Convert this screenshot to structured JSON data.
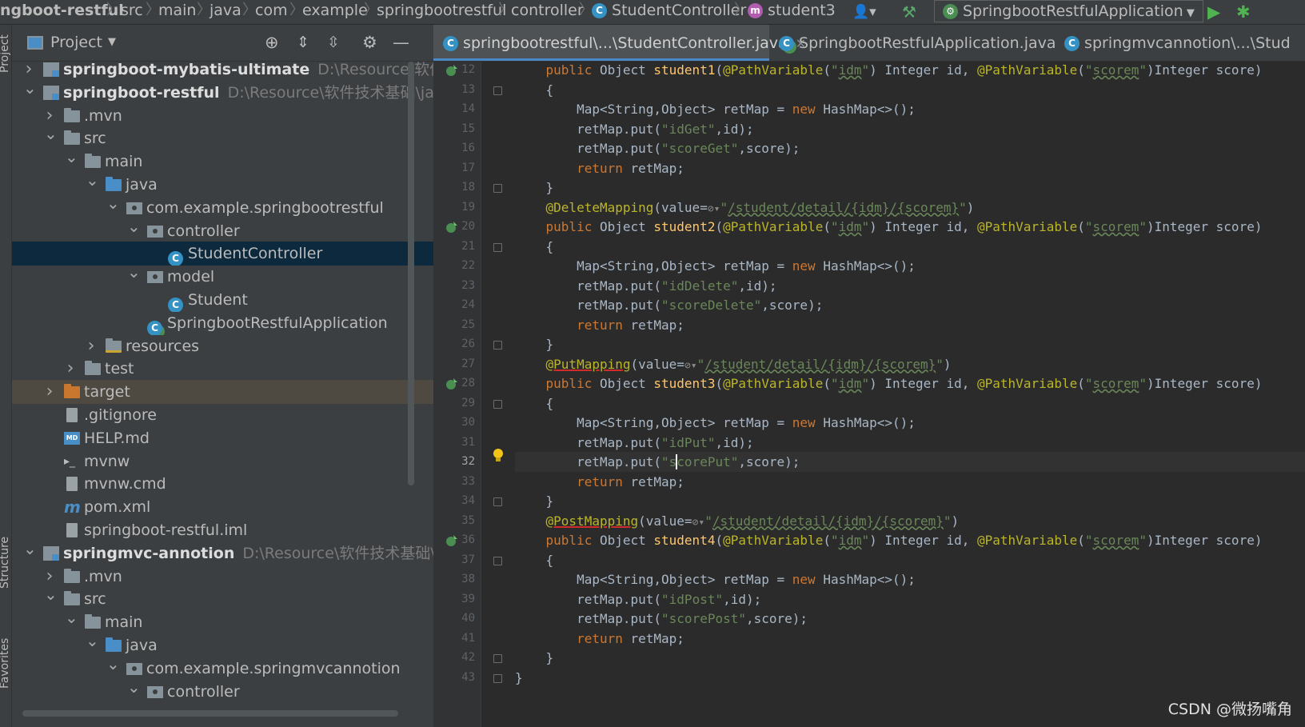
{
  "breadcrumb": [
    "ngboot-restful",
    "src",
    "main",
    "java",
    "com",
    "example",
    "springbootrestful",
    "controller",
    "StudentController",
    "student3"
  ],
  "run_config": "SpringbootRestfulApplication",
  "side_labels": [
    "Project",
    "Structure",
    "Favorites"
  ],
  "project_panel": {
    "title": "Project"
  },
  "tree": [
    {
      "label": "springboot-mybatis-ultimate",
      "path": "D:\\Resource\\软件技术基",
      "depth": 0,
      "expanded": false,
      "icon": "module",
      "bold": true
    },
    {
      "label": "springboot-restful",
      "path": "D:\\Resource\\软件技术基础\\java-le",
      "depth": 0,
      "expanded": true,
      "icon": "module",
      "bold": true
    },
    {
      "label": ".mvn",
      "depth": 1,
      "expanded": false,
      "icon": "folder"
    },
    {
      "label": "src",
      "depth": 1,
      "expanded": true,
      "icon": "folder"
    },
    {
      "label": "main",
      "depth": 2,
      "expanded": true,
      "icon": "folder"
    },
    {
      "label": "java",
      "depth": 3,
      "expanded": true,
      "icon": "folder-blue"
    },
    {
      "label": "com.example.springbootrestful",
      "depth": 4,
      "expanded": true,
      "icon": "package"
    },
    {
      "label": "controller",
      "depth": 5,
      "expanded": true,
      "icon": "package"
    },
    {
      "label": "StudentController",
      "depth": 6,
      "icon": "class",
      "selected": true
    },
    {
      "label": "model",
      "depth": 5,
      "expanded": true,
      "icon": "package"
    },
    {
      "label": "Student",
      "depth": 6,
      "icon": "class"
    },
    {
      "label": "SpringbootRestfulApplication",
      "depth": 5,
      "icon": "spring-class"
    },
    {
      "label": "resources",
      "depth": 3,
      "expanded": false,
      "icon": "resources"
    },
    {
      "label": "test",
      "depth": 2,
      "expanded": false,
      "icon": "folder"
    },
    {
      "label": "target",
      "depth": 1,
      "expanded": false,
      "icon": "folder-orange",
      "highlight": true
    },
    {
      "label": ".gitignore",
      "depth": 1,
      "icon": "file"
    },
    {
      "label": "HELP.md",
      "depth": 1,
      "icon": "md"
    },
    {
      "label": "mvnw",
      "depth": 1,
      "icon": "terminal"
    },
    {
      "label": "mvnw.cmd",
      "depth": 1,
      "icon": "file"
    },
    {
      "label": "pom.xml",
      "depth": 1,
      "icon": "maven"
    },
    {
      "label": "springboot-restful.iml",
      "depth": 1,
      "icon": "file"
    },
    {
      "label": "springmvc-annotion",
      "path": "D:\\Resource\\软件技术基础\\java-",
      "depth": 0,
      "expanded": true,
      "icon": "module",
      "bold": true
    },
    {
      "label": ".mvn",
      "depth": 1,
      "expanded": false,
      "icon": "folder"
    },
    {
      "label": "src",
      "depth": 1,
      "expanded": true,
      "icon": "folder"
    },
    {
      "label": "main",
      "depth": 2,
      "expanded": true,
      "icon": "folder"
    },
    {
      "label": "java",
      "depth": 3,
      "expanded": true,
      "icon": "folder-blue"
    },
    {
      "label": "com.example.springmvcannotion",
      "depth": 4,
      "expanded": true,
      "icon": "package"
    },
    {
      "label": "controller",
      "depth": 5,
      "expanded": true,
      "icon": "package"
    }
  ],
  "tabs": [
    {
      "label": "springbootrestful\\...\\StudentController.java",
      "icon": "class",
      "active": true,
      "closable": true
    },
    {
      "label": "SpringbootRestfulApplication.java",
      "icon": "spring-class",
      "closable": true
    },
    {
      "label": "springmvcannotion\\...\\Stud",
      "icon": "class"
    }
  ],
  "code": {
    "current_line": 32,
    "lines": [
      {
        "n": 12,
        "t": "    public Object student1(@PathVariable(\"idm\") Integer id, @PathVariable(\"scorem\")Integer score)"
      },
      {
        "n": 13,
        "t": "    {"
      },
      {
        "n": 14,
        "t": "        Map<String,Object> retMap = new HashMap<>();"
      },
      {
        "n": 15,
        "t": "        retMap.put(\"idGet\",id);"
      },
      {
        "n": 16,
        "t": "        retMap.put(\"scoreGet\",score);"
      },
      {
        "n": 17,
        "t": "        return retMap;"
      },
      {
        "n": 18,
        "t": "    }"
      },
      {
        "n": 19,
        "t": "    @DeleteMapping(value=\"/student/detail/{idm}/{scorem}\")"
      },
      {
        "n": 20,
        "t": "    public Object student2(@PathVariable(\"idm\") Integer id, @PathVariable(\"scorem\")Integer score)"
      },
      {
        "n": 21,
        "t": "    {"
      },
      {
        "n": 22,
        "t": "        Map<String,Object> retMap = new HashMap<>();"
      },
      {
        "n": 23,
        "t": "        retMap.put(\"idDelete\",id);"
      },
      {
        "n": 24,
        "t": "        retMap.put(\"scoreDelete\",score);"
      },
      {
        "n": 25,
        "t": "        return retMap;"
      },
      {
        "n": 26,
        "t": "    }"
      },
      {
        "n": 27,
        "t": "    @PutMapping(value=\"/student/detail/{idm}/{scorem}\")"
      },
      {
        "n": 28,
        "t": "    public Object student3(@PathVariable(\"idm\") Integer id, @PathVariable(\"scorem\")Integer score)"
      },
      {
        "n": 29,
        "t": "    {"
      },
      {
        "n": 30,
        "t": "        Map<String,Object> retMap = new HashMap<>();"
      },
      {
        "n": 31,
        "t": "        retMap.put(\"idPut\",id);"
      },
      {
        "n": 32,
        "t": "        retMap.put(\"scorePut\",score);"
      },
      {
        "n": 33,
        "t": "        return retMap;"
      },
      {
        "n": 34,
        "t": "    }"
      },
      {
        "n": 35,
        "t": "    @PostMapping(value=\"/student/detail/{idm}/{scorem}\")"
      },
      {
        "n": 36,
        "t": "    public Object student4(@PathVariable(\"idm\") Integer id, @PathVariable(\"scorem\")Integer score)"
      },
      {
        "n": 37,
        "t": "    {"
      },
      {
        "n": 38,
        "t": "        Map<String,Object> retMap = new HashMap<>();"
      },
      {
        "n": 39,
        "t": "        retMap.put(\"idPost\",id);"
      },
      {
        "n": 40,
        "t": "        retMap.put(\"scorePost\",score);"
      },
      {
        "n": 41,
        "t": "        return retMap;"
      },
      {
        "n": 42,
        "t": "    }"
      },
      {
        "n": 43,
        "t": "}"
      }
    ]
  },
  "watermark": "CSDN @微扬嘴角",
  "colors": {
    "keyword": "#cc7832",
    "annotation": "#bbb529",
    "string": "#6a8759",
    "method": "#ffc66d",
    "selection": "#0d293e",
    "tab_underline": "#4a88c7"
  }
}
